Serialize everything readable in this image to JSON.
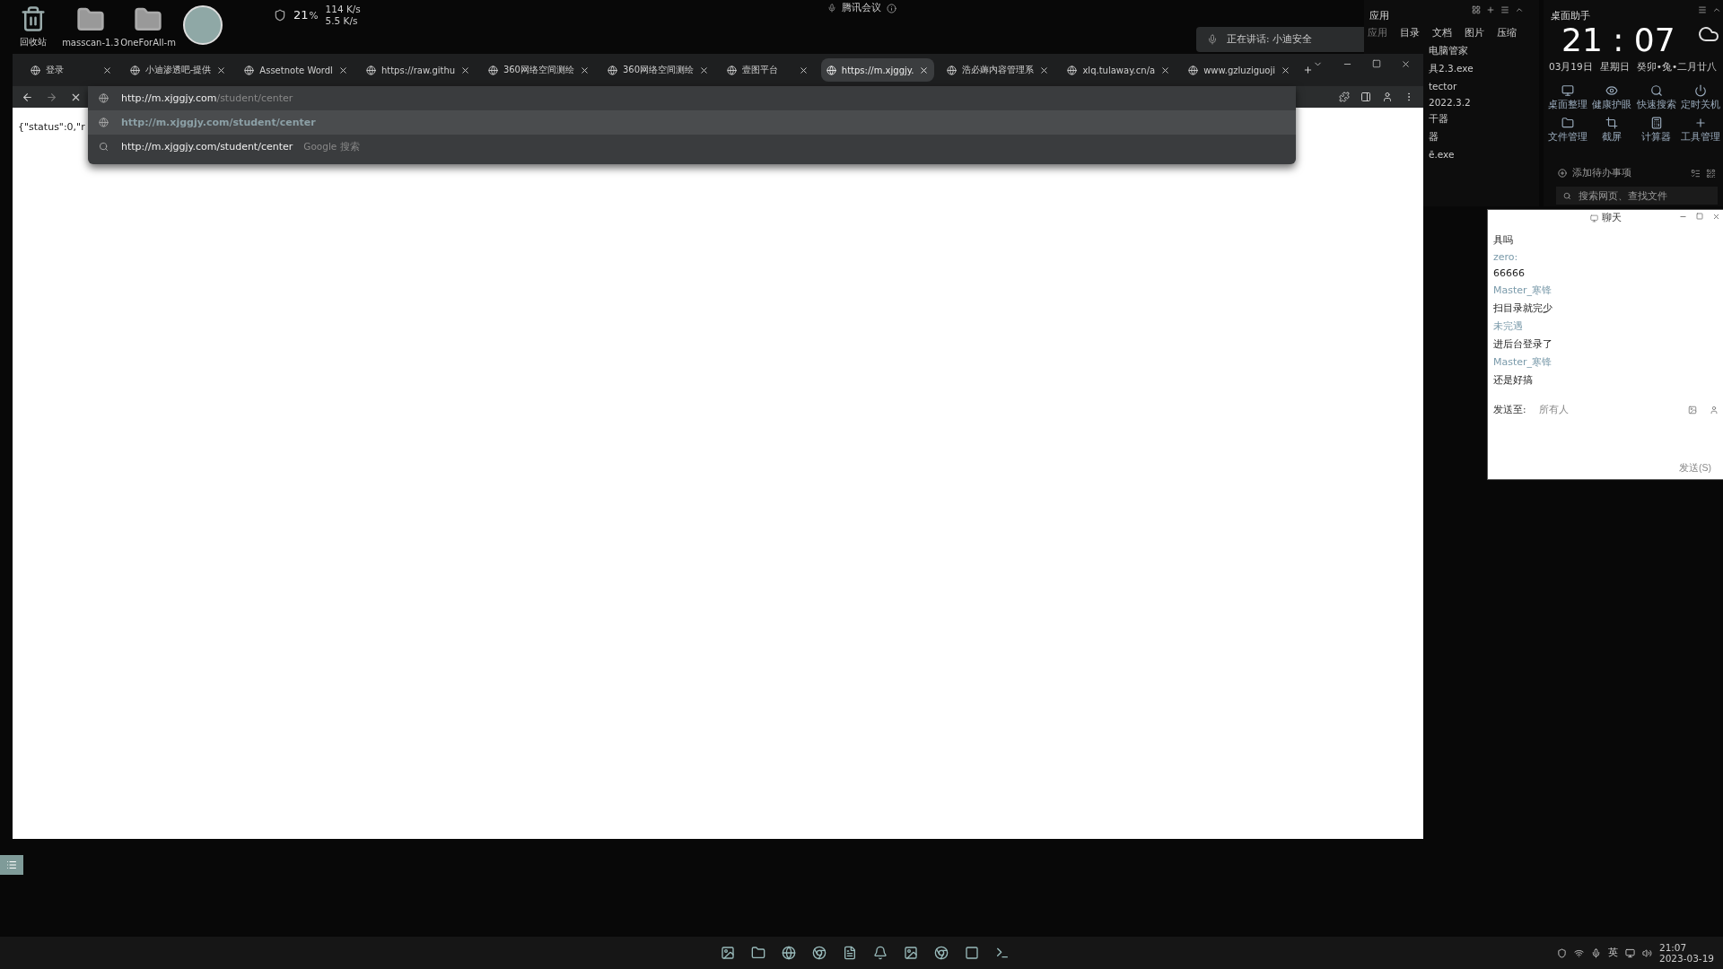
{
  "desktop_icons": [
    {
      "kind": "bin",
      "label": "回收站"
    },
    {
      "kind": "folder",
      "label": "masscan-1.3"
    },
    {
      "kind": "folder",
      "label": "OneForAll-m"
    }
  ],
  "net_monitor": {
    "cpu": "21",
    "unit": "%",
    "up": "114 K/s",
    "down": "5.5 K/s"
  },
  "meeting_bar": {
    "title": "腾讯会议"
  },
  "speaking": {
    "text": "正在讲话: 小迪安全"
  },
  "browser": {
    "tabs": [
      {
        "label": "登录",
        "selected": false
      },
      {
        "label": "小迪渗透吧-提供",
        "selected": false
      },
      {
        "label": "Assetnote Wordl",
        "selected": false
      },
      {
        "label": "https://raw.githu",
        "selected": false
      },
      {
        "label": "360网络空间测绘",
        "selected": false
      },
      {
        "label": "360网络空间测绘",
        "selected": false
      },
      {
        "label": "壹图平台",
        "selected": false
      },
      {
        "label": "https://m.xjggjy.",
        "selected": true
      },
      {
        "label": "浩必薅内容管理系",
        "selected": false
      },
      {
        "label": "xlq.tulaway.cn/a",
        "selected": false
      },
      {
        "label": "www.gzluziguoji",
        "selected": false
      }
    ],
    "address": {
      "host": "http://m.xjggjy.com",
      "path": "/student/center"
    },
    "suggestions": [
      {
        "kind": "url",
        "text": "http://m.xjggjy.com/student/center"
      },
      {
        "kind": "search",
        "text": "http://m.xjggjy.com/student/center",
        "hint": "Google 搜索"
      }
    ],
    "content": "{\"status\":0,\"r"
  },
  "apps_panel": {
    "title": "应用",
    "tabs": [
      "应用",
      "目录",
      "文档",
      "图片",
      "压缩"
    ],
    "items": [
      "电脑管家",
      "具2.3.exe",
      "tector",
      "2022.3.2",
      "干器",
      "器",
      "ē.exe"
    ]
  },
  "assistant": {
    "title": "桌面助手",
    "time": "21 : 07",
    "date": "03月19日",
    "weekday": "星期日",
    "lunar": "癸卯•兔•二月廿八",
    "tools": [
      {
        "kind": "desk",
        "label": "桌面整理"
      },
      {
        "kind": "eye",
        "label": "健康护眼"
      },
      {
        "kind": "search",
        "label": "快速搜索"
      },
      {
        "kind": "power",
        "label": "定时关机"
      },
      {
        "kind": "folder",
        "label": "文件管理"
      },
      {
        "kind": "crop",
        "label": "截屏"
      },
      {
        "kind": "calc",
        "label": "计算器"
      },
      {
        "kind": "plus",
        "label": "工具管理"
      }
    ],
    "todo": "添加待办事项",
    "search_placeholder": "搜索网页、查找文件"
  },
  "chat": {
    "title": "聊天",
    "messages": [
      {
        "kind": "text",
        "text": "具吗"
      },
      {
        "kind": "sender",
        "text": "zero:"
      },
      {
        "kind": "text",
        "text": "66666"
      },
      {
        "kind": "sender",
        "text": "Master_寒锋"
      },
      {
        "kind": "text",
        "text": "扫目录就完少"
      },
      {
        "kind": "sender",
        "text": "未完遇"
      },
      {
        "kind": "text",
        "text": "进后台登录了"
      },
      {
        "kind": "sender",
        "text": "Master_寒锋"
      },
      {
        "kind": "text",
        "text": "还是好搞"
      }
    ],
    "send_to_label": "发送至:",
    "send_to": "所有人",
    "send_button": "发送(S)"
  },
  "taskbar": {
    "time": "21:07",
    "date": "2023-03-19",
    "ime": "英"
  }
}
